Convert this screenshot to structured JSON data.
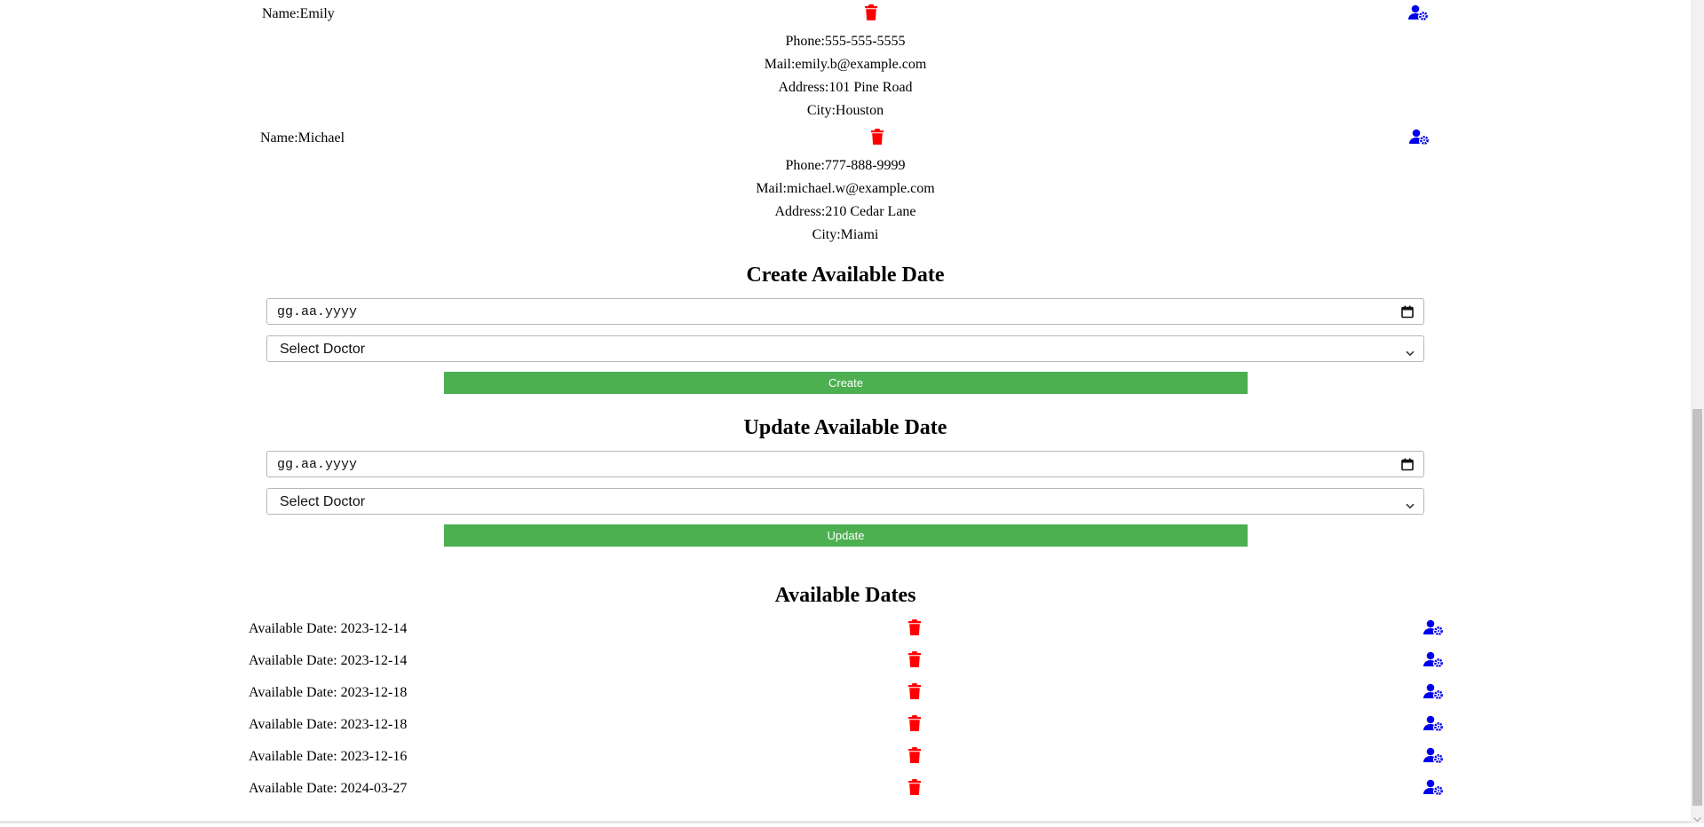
{
  "doctors": [
    {
      "name": "Name:Emily",
      "phone_label": "Phone:",
      "phone": "555-555-5555",
      "mail_label": "Mail:",
      "mail": "emily.b@example.com",
      "address_label": "Address:",
      "address": "101 Pine Road",
      "city_label": "City:",
      "city": "Houston"
    },
    {
      "name": "Name:Michael",
      "phone_label": "Phone:",
      "phone": "777-888-9999",
      "mail_label": "Mail:",
      "mail": "michael.w@example.com",
      "address_label": "Address:",
      "address": "210 Cedar Lane",
      "city_label": "City:",
      "city": "Miami"
    }
  ],
  "create_section": {
    "title": "Create Available Date",
    "date_placeholder": "gg.aa.yyyy",
    "select_value": "Select Doctor",
    "button_label": "Create"
  },
  "update_section": {
    "title": "Update Available Date",
    "date_placeholder": "gg.aa.yyyy",
    "select_value": "Select Doctor",
    "button_label": "Update"
  },
  "available_dates": {
    "title": "Available Dates",
    "rows": [
      "Available Date: 2023-12-14",
      "Available Date: 2023-12-14",
      "Available Date: 2023-12-18",
      "Available Date: 2023-12-18",
      "Available Date: 2023-12-16",
      "Available Date: 2024-03-27"
    ]
  },
  "icons": {
    "delete": "trash-icon",
    "edit": "user-gear-icon",
    "calendar": "calendar-icon",
    "chevron": "chevron-down-icon"
  },
  "colors": {
    "delete_icon": "#ff0000",
    "edit_icon": "#0000ee",
    "button_green": "#4caf50",
    "button_text": "#ffffff"
  }
}
